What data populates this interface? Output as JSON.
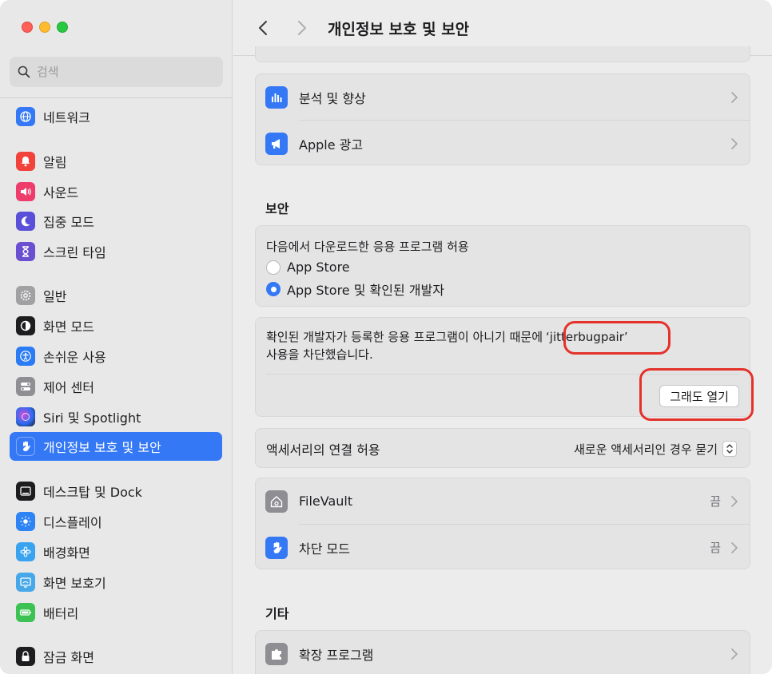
{
  "window": {
    "title": "개인정보 보호 및 보안"
  },
  "search": {
    "placeholder": "검색"
  },
  "sidebar": {
    "items": [
      {
        "label": "네트워크",
        "icon": "globe-icon",
        "color": "#3478f6"
      },
      {
        "label": "알림",
        "icon": "bell-icon",
        "color": "#f1433b"
      },
      {
        "label": "사운드",
        "icon": "speaker-icon",
        "color": "#ee3c6b"
      },
      {
        "label": "집중 모드",
        "icon": "moon-icon",
        "color": "#5a4fd8"
      },
      {
        "label": "스크린 타임",
        "icon": "hourglass-icon",
        "color": "#6a4fd1"
      },
      {
        "label": "일반",
        "icon": "gear-icon",
        "color": "#a1a0a3"
      },
      {
        "label": "화면 모드",
        "icon": "appearance-icon",
        "color": "#1d1d1f"
      },
      {
        "label": "손쉬운 사용",
        "icon": "accessibility-icon",
        "color": "#2a7bf4"
      },
      {
        "label": "제어 센터",
        "icon": "toggles-icon",
        "color": "#8e8e93"
      },
      {
        "label": "Siri 및 Spotlight",
        "icon": "siri-icon",
        "color": "#2b2b3a"
      },
      {
        "label": "개인정보 보호 및 보안",
        "icon": "hand-icon",
        "color": "#3478f6"
      },
      {
        "label": "데스크탑 및 Dock",
        "icon": "dock-icon",
        "color": "#1d1d1f"
      },
      {
        "label": "디스플레이",
        "icon": "sun-icon",
        "color": "#2f84f5"
      },
      {
        "label": "배경화면",
        "icon": "flower-icon",
        "color": "#39a3f0"
      },
      {
        "label": "화면 보호기",
        "icon": "screensaver-icon",
        "color": "#46a8e8"
      },
      {
        "label": "배터리",
        "icon": "battery-icon",
        "color": "#3cc153"
      },
      {
        "label": "잠금 화면",
        "icon": "lock-icon",
        "color": "#1d1d1f"
      }
    ]
  },
  "main": {
    "analytics": {
      "label": "분석 및 향상",
      "icon": "chart-icon"
    },
    "apple_ads": {
      "label": "Apple 광고",
      "icon": "megaphone-icon"
    },
    "security_title": "보안",
    "download": {
      "label": "다음에서 다운로드한 응용 프로그램 허용",
      "options": [
        {
          "label": "App Store",
          "selected": false
        },
        {
          "label": "App Store 및 확인된 개발자",
          "selected": true
        }
      ]
    },
    "blocked": {
      "text_line1": "확인된 개발자가 등록한 응용 프로그램이 아니기 때문에",
      "app_name": "‘jitterbugpair’",
      "text_line2": "사용을 차단했습니다.",
      "open_button": "그래도 열기"
    },
    "accessory": {
      "label": "액세서리의 연결 허용",
      "value": "새로운 액세서리인 경우 묻기"
    },
    "filevault": {
      "label": "FileVault",
      "value": "끔",
      "icon": "house-safe-icon"
    },
    "lockdown": {
      "label": "차단 모드",
      "value": "끔",
      "icon": "hand-icon"
    },
    "other_title": "기타",
    "extensions": {
      "label": "확장 프로그램",
      "icon": "puzzle-icon"
    }
  },
  "colors": {
    "accent": "#3478f6",
    "annotation": "#e4322b"
  }
}
